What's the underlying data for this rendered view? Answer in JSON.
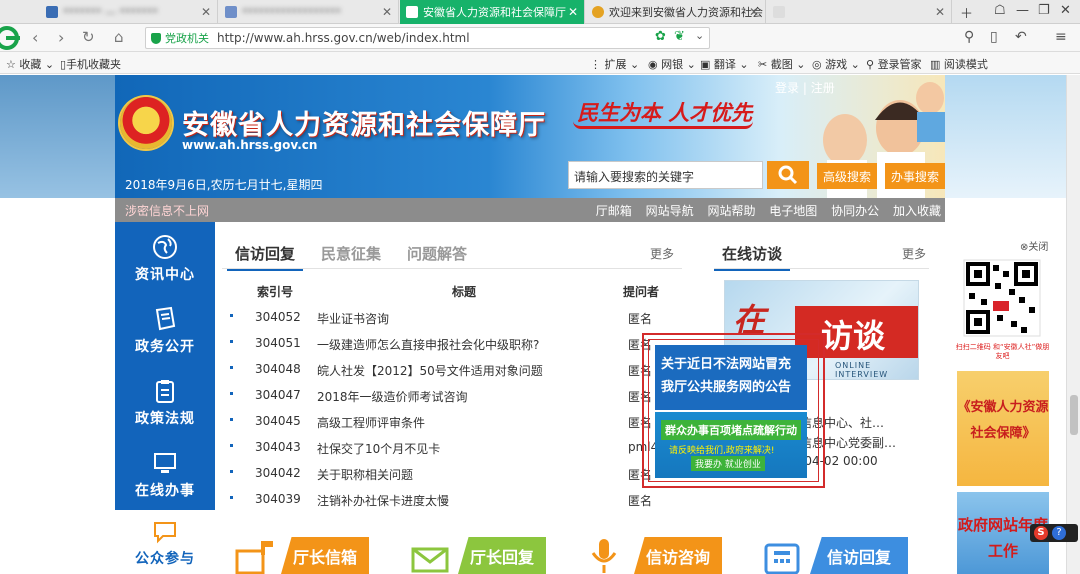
{
  "browser": {
    "tabs": [
      {
        "label": "******* — *******",
        "blurred": true
      },
      {
        "label": "******************",
        "blurred": true
      },
      {
        "label": "安徽省人力资源和社会保障厅",
        "blurred": false
      },
      {
        "label": "欢迎来到安徽省人力资源和社会",
        "blurred": false
      }
    ],
    "url_prefix": "党政机关",
    "url": "http://www.ah.hrss.gov.cn/web/index.html",
    "bookmarks_left": [
      "收藏",
      "手机收藏夹"
    ],
    "bookmarks_right": [
      "扩展",
      "网银",
      "翻译",
      "截图",
      "游戏",
      "登录管家",
      "阅读模式"
    ]
  },
  "site": {
    "title": "安徽省人力资源和社会保障厅",
    "domain": "www.ah.hrss.gov.cn",
    "slogan": "民生为本  人才优先",
    "date": "2018年9月6日,农历七月廿七,星期四",
    "login": "登录",
    "register": "注册",
    "search_placeholder": "请输入要搜索的关键字",
    "advanced_search": "高级搜索",
    "affairs_search": "办事搜索",
    "secret_notice": "涉密信息不上网",
    "quick_links": [
      "厅邮箱",
      "网站导航",
      "网站帮助",
      "电子地图",
      "协同办公",
      "加入收藏"
    ]
  },
  "leftnav": [
    {
      "label": "资讯中心",
      "icon": "globe-icon"
    },
    {
      "label": "政务公开",
      "icon": "document-icon"
    },
    {
      "label": "政策法规",
      "icon": "clipboard-icon"
    },
    {
      "label": "在线办事",
      "icon": "monitor-icon"
    },
    {
      "label": "公众参与",
      "icon": "chat-icon"
    }
  ],
  "content": {
    "tabs": [
      "信访回复",
      "民意征集",
      "问题解答"
    ],
    "more": "更多",
    "headers": {
      "id": "索引号",
      "title": "标题",
      "author": "提问者"
    },
    "rows": [
      {
        "id": "304052",
        "title": "毕业证书咨询",
        "author": "匿名"
      },
      {
        "id": "304051",
        "title": "一级建造师怎么直接申报社会化中级职称?",
        "author": "匿名"
      },
      {
        "id": "304048",
        "title": "皖人社发【2012】50号文件适用对象问题",
        "author": "匿名"
      },
      {
        "id": "304047",
        "title": "2018年一级造价师考试咨询",
        "author": "匿名"
      },
      {
        "id": "304045",
        "title": "高级工程师评审条件",
        "author": "匿名"
      },
      {
        "id": "304043",
        "title": "社保交了10个月不见卡",
        "author": "pml4"
      },
      {
        "id": "304042",
        "title": "关于职称相关问题",
        "author": "匿名"
      },
      {
        "id": "304039",
        "title": "注销补办社保卡进度太慢",
        "author": "匿名"
      }
    ]
  },
  "online": {
    "title": "在线访谈",
    "more": "更多",
    "banner_zai": "在",
    "banner_fang": "访谈",
    "banner_en": "ONLINE INTERVIEW",
    "items": [
      "信息中心、社…",
      "信息中心党委副…",
      "-04-02 00:00"
    ]
  },
  "popup": {
    "line1": "关于近日不法网站冒充",
    "line2": "我厅公共服务网的公告",
    "banner1": "群众办事百项堵点疏解行动",
    "banner2": "请反映给我们,政府来解决!",
    "banner3": "我要办 就业创业"
  },
  "bottom_tiles": [
    {
      "label": "厅长信箱",
      "color": "#f39418"
    },
    {
      "label": "厅长回复",
      "color": "#8cc63e"
    },
    {
      "label": "信访咨询",
      "color": "#f39418"
    },
    {
      "label": "信访回复",
      "color": "#3d8ee0"
    }
  ],
  "sidebar": {
    "close": "关闭",
    "qr_caption": "扫扫二维码 和“安徽人社”做朋友吧",
    "ad1": "《安徽人力资源社会保障》",
    "ad2": "政府网站年度工作"
  },
  "colors": {
    "primary_blue": "#1264bb",
    "accent_orange": "#f39418",
    "active_tab_green": "#17b26a"
  }
}
